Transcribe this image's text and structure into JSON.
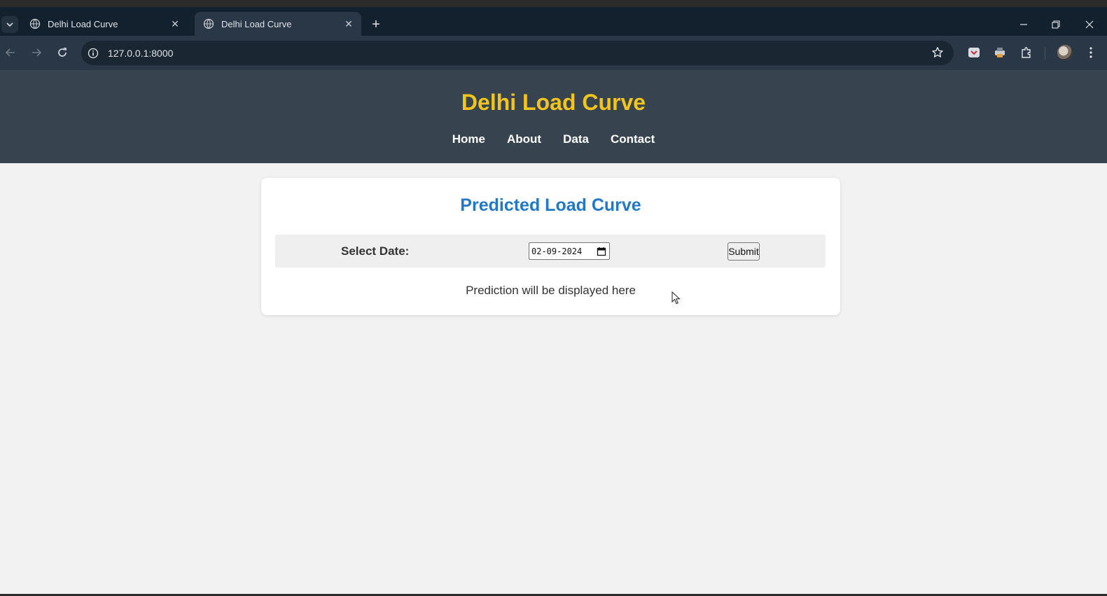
{
  "browser": {
    "tabs": [
      {
        "title": "Delhi Load Curve",
        "active": false,
        "favicon": "globe-icon"
      },
      {
        "title": "Delhi Load Curve",
        "active": true,
        "favicon": "globe-icon"
      }
    ],
    "url": "127.0.0.1:8000",
    "icons": [
      "tab-search-icon",
      "close-icon",
      "plus-icon",
      "minimize-icon",
      "restore-icon",
      "back-icon",
      "forward-icon",
      "reload-icon",
      "info-icon",
      "star-icon",
      "pocket-icon",
      "printer-icon",
      "extensions-icon",
      "avatar",
      "more-menu-icon"
    ]
  },
  "site": {
    "title": "Delhi Load Curve",
    "nav": [
      "Home",
      "About",
      "Data",
      "Contact"
    ]
  },
  "card": {
    "title": "Predicted Load Curve",
    "date_label": "Select Date:",
    "date_value": "02-09-2024",
    "submit_label": "Submit",
    "prediction_text": "Prediction will be displayed here"
  },
  "colors": {
    "header_bg": "#374450",
    "title_yellow": "#f3c41b",
    "card_title_blue": "#1f78c8",
    "page_bg": "#f2f2f2"
  }
}
